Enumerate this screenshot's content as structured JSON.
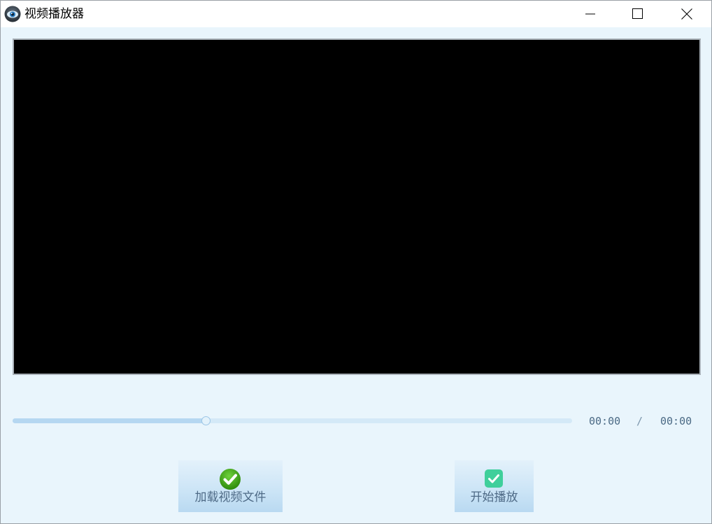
{
  "window": {
    "title": "视频播放器",
    "app_icon": "video-camera-eye-icon",
    "controls": {
      "minimize_icon": "minimize-icon",
      "maximize_icon": "maximize-icon",
      "close_icon": "close-icon"
    }
  },
  "player": {
    "progress": 0.345,
    "current_time": "00:00",
    "separator": "/",
    "total_time": "00:00"
  },
  "buttons": {
    "load": {
      "label": "加载视频文件",
      "icon": "green-check-circle-icon"
    },
    "play": {
      "label": "开始播放",
      "icon": "teal-check-square-icon"
    }
  },
  "colors": {
    "window_bg": "#e9f5fc",
    "video_bg": "#000000",
    "slider_track": "#d4e9f7",
    "slider_fill": "#b5d7f1",
    "text_muted": "#4b6a85",
    "check_green": "#3aa312",
    "check_teal": "#3fcf9b"
  }
}
